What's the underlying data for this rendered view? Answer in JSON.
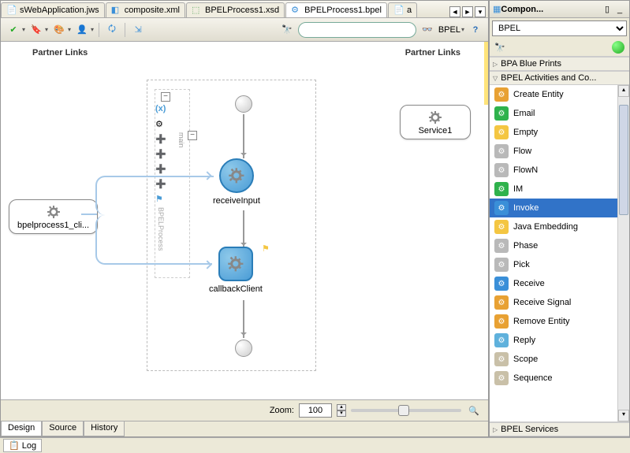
{
  "tabs": [
    {
      "label": "sWebApplication.jws",
      "icon": "app-icon"
    },
    {
      "label": "composite.xml",
      "icon": "composite-icon"
    },
    {
      "label": "BPELProcess1.xsd",
      "icon": "xsd-icon"
    },
    {
      "label": "BPELProcess1.bpel",
      "icon": "bpel-icon",
      "active": true
    },
    {
      "label": "a",
      "icon": "file-icon"
    }
  ],
  "toolbar": {
    "search_placeholder": "",
    "bpel_label": "BPEL"
  },
  "canvas": {
    "left_header": "Partner Links",
    "right_header": "Partner Links",
    "partner_left": "bpelprocess1_cli...",
    "partner_right": "Service1",
    "activity1": "receiveInput",
    "activity2": "callbackClient",
    "lane_label": "main",
    "lane_label2": "BPELProcess"
  },
  "zoom": {
    "label": "Zoom:",
    "value": "100"
  },
  "bottom_tabs": [
    "Design",
    "Source",
    "History"
  ],
  "log_label": "Log",
  "palette": {
    "title": "Compon...",
    "select_value": "BPEL",
    "section1": "BPA Blue Prints",
    "section2": "BPEL Activities and Co...",
    "section3": "BPEL Services",
    "items": [
      {
        "label": "Create Entity",
        "color": "#e8a133"
      },
      {
        "label": "Email",
        "color": "#2fb24c"
      },
      {
        "label": "Empty",
        "color": "#f4c642"
      },
      {
        "label": "Flow",
        "color": "#b9b9b9"
      },
      {
        "label": "FlowN",
        "color": "#b9b9b9"
      },
      {
        "label": "IM",
        "color": "#2fb24c"
      },
      {
        "label": "Invoke",
        "color": "#3a8fd8",
        "selected": true
      },
      {
        "label": "Java Embedding",
        "color": "#f4c642"
      },
      {
        "label": "Phase",
        "color": "#b9b9b9"
      },
      {
        "label": "Pick",
        "color": "#b9b9b9"
      },
      {
        "label": "Receive",
        "color": "#3a8fd8"
      },
      {
        "label": "Receive Signal",
        "color": "#e8a133"
      },
      {
        "label": "Remove Entity",
        "color": "#e8a133"
      },
      {
        "label": "Reply",
        "color": "#5fb1dc"
      },
      {
        "label": "Scope",
        "color": "#c9c0a8"
      },
      {
        "label": "Sequence",
        "color": "#c9c0a8"
      }
    ]
  }
}
